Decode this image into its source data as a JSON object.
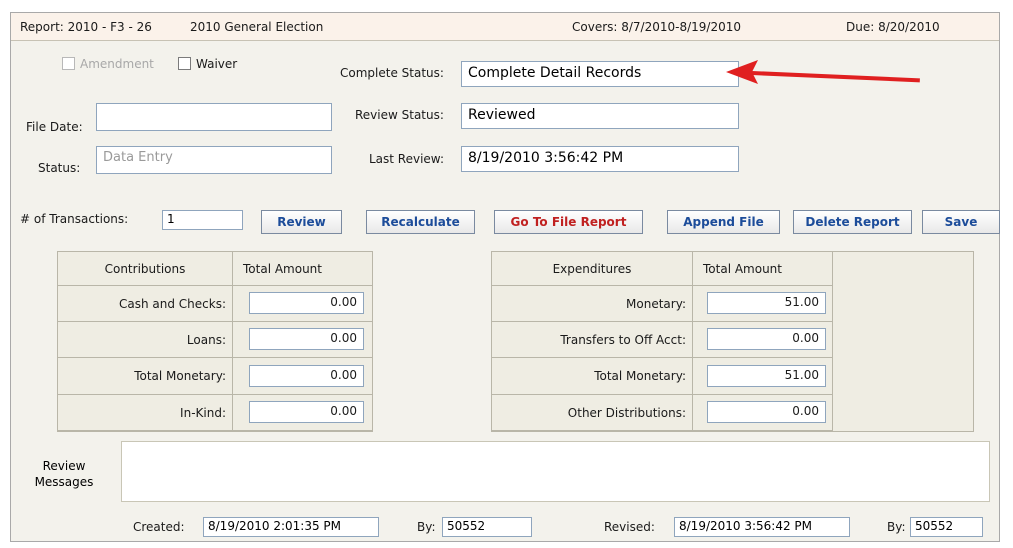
{
  "header": {
    "report": "Report: 2010 - F3 - 26",
    "election": "2010 General Election",
    "covers": "Covers:  8/7/2010-8/19/2010",
    "due": "Due:  8/20/2010"
  },
  "checkboxes": {
    "amendment": "Amendment",
    "waiver": "Waiver"
  },
  "labels": {
    "complete_status": "Complete Status:",
    "review_status": "Review Status:",
    "last_review": "Last Review:",
    "file_date": "File Date:",
    "status": "Status:",
    "num_transactions": "# of Transactions:"
  },
  "values": {
    "complete_status": "Complete Detail Records",
    "review_status": "Reviewed",
    "last_review": "8/19/2010 3:56:42 PM",
    "file_date": "",
    "status": "Data Entry",
    "num_transactions": "1"
  },
  "buttons": {
    "review": "Review",
    "recalculate": "Recalculate",
    "go_to_file_report": "Go To File Report",
    "append_file": "Append File",
    "delete_report": "Delete Report",
    "save": "Save"
  },
  "contributions": {
    "header": "Contributions",
    "amount_header": "Total Amount",
    "rows": [
      {
        "label": "Cash and Checks:",
        "value": "0.00"
      },
      {
        "label": "Loans:",
        "value": "0.00"
      },
      {
        "label": "Total Monetary:",
        "value": "0.00"
      },
      {
        "label": "In-Kind:",
        "value": "0.00"
      }
    ]
  },
  "expenditures": {
    "header": "Expenditures",
    "amount_header": "Total Amount",
    "rows": [
      {
        "label": "Monetary:",
        "value": "51.00"
      },
      {
        "label": "Transfers to Off Acct:",
        "value": "0.00"
      },
      {
        "label": "Total Monetary:",
        "value": "51.00"
      },
      {
        "label": "Other Distributions:",
        "value": "0.00"
      }
    ]
  },
  "review_messages": {
    "label_line1": "Review",
    "label_line2": "Messages",
    "text": ""
  },
  "footer": {
    "created_label": "Created:",
    "created_value": "8/19/2010 2:01:35 PM",
    "by1_label": "By:",
    "by1_value": "50552",
    "revised_label": "Revised:",
    "revised_value": "8/19/2010 3:56:42 PM",
    "by2_label": "By:",
    "by2_value": "50552"
  },
  "colors": {
    "accent_arrow": "#e02020",
    "button_text": "#1c4c9a",
    "danger_button_text": "#c02020"
  }
}
